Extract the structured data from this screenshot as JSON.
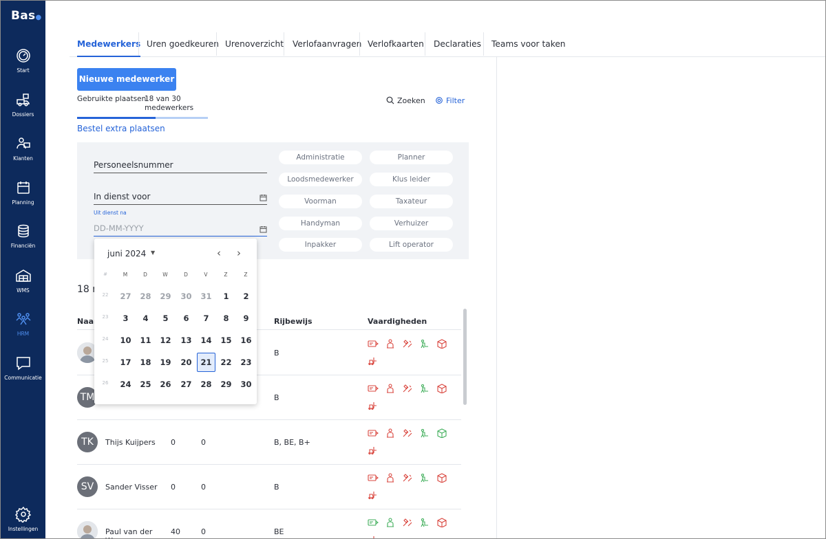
{
  "app": {
    "logo": "Bas"
  },
  "sidebar": {
    "items": [
      {
        "label": "Start",
        "icon": "gauge-icon"
      },
      {
        "label": "Dossiers",
        "icon": "truck-icon"
      },
      {
        "label": "Klanten",
        "icon": "customers-icon"
      },
      {
        "label": "Planning",
        "icon": "calendar-icon"
      },
      {
        "label": "Financiën",
        "icon": "coins-icon"
      },
      {
        "label": "WMS",
        "icon": "warehouse-icon"
      },
      {
        "label": "HRM",
        "icon": "people-icon",
        "active": true
      },
      {
        "label": "Communicatie",
        "icon": "chat-icon"
      },
      {
        "label": "Instellingen",
        "icon": "gear-icon"
      }
    ]
  },
  "tabs": [
    "Medewerkers",
    "Uren goedkeuren",
    "Urenoverzicht",
    "Verlofaanvragen",
    "Verlofkaarten",
    "Declaraties",
    "Teams voor taken"
  ],
  "toolbar": {
    "new_employee": "Nieuwe medewerker",
    "seats_label": "Gebruikte plaatsen",
    "seats_count": "18 van 30 medewerkers",
    "seats_used_fraction": 0.6,
    "order_link": "Bestel extra plaatsen",
    "search": "Zoeken",
    "filter": "Filter"
  },
  "filters": {
    "personnel_number": "Personeelsnummer",
    "in_service_before": "In dienst voor",
    "out_of_service_after_label": "Uit dienst na",
    "out_of_service_after_placeholder": "DD-MM-YYYY",
    "roles": [
      "Administratie",
      "Planner",
      "Loodsmedewerker",
      "Klus leider",
      "Voorman",
      "Taxateur",
      "Handyman",
      "Verhuizer",
      "Inpakker",
      "Lift operator"
    ]
  },
  "list": {
    "count_text": "18 r",
    "headers": {
      "name": "Naar",
      "license": "Rijbewijs",
      "skills": "Vaardigheden"
    },
    "rows": [
      {
        "initials": "",
        "photo": true,
        "name": "",
        "c1": "",
        "c2": "",
        "license": "B",
        "skills": [
          "red",
          "red",
          "red",
          "green",
          "red",
          "red"
        ]
      },
      {
        "initials": "TM",
        "photo": false,
        "name": "",
        "c1": "",
        "c2": "",
        "license": "B",
        "skills": [
          "red",
          "red",
          "red",
          "green",
          "red",
          "red"
        ]
      },
      {
        "initials": "TK",
        "photo": false,
        "name": "Thijs Kuijpers",
        "c1": "0",
        "c2": "0",
        "license": "B, BE, B+",
        "skills": [
          "red",
          "red",
          "red",
          "green",
          "green",
          "red"
        ]
      },
      {
        "initials": "SV",
        "photo": false,
        "name": "Sander Visser",
        "c1": "0",
        "c2": "0",
        "license": "B",
        "skills": [
          "red",
          "red",
          "red",
          "green",
          "red",
          "red"
        ]
      },
      {
        "initials": "",
        "photo": true,
        "name": "Paul van der Wees",
        "c1": "40",
        "c2": "0",
        "license": "BE",
        "skills": [
          "green",
          "green",
          "red",
          "green",
          "red",
          "red"
        ]
      }
    ]
  },
  "datepicker": {
    "month_label": "juni 2024",
    "week_header": "#",
    "weekdays": [
      "M",
      "D",
      "W",
      "D",
      "V",
      "Z",
      "Z"
    ],
    "weeks": [
      {
        "wk": "22",
        "days": [
          "27",
          "28",
          "29",
          "30",
          "31",
          "1",
          "2"
        ],
        "muted": [
          true,
          true,
          true,
          true,
          true,
          false,
          false
        ]
      },
      {
        "wk": "23",
        "days": [
          "3",
          "4",
          "5",
          "6",
          "7",
          "8",
          "9"
        ],
        "muted": [
          false,
          false,
          false,
          false,
          false,
          false,
          false
        ]
      },
      {
        "wk": "24",
        "days": [
          "10",
          "11",
          "12",
          "13",
          "14",
          "15",
          "16"
        ],
        "muted": [
          false,
          false,
          false,
          false,
          false,
          false,
          false
        ]
      },
      {
        "wk": "25",
        "days": [
          "17",
          "18",
          "19",
          "20",
          "21",
          "22",
          "23"
        ],
        "muted": [
          false,
          false,
          false,
          false,
          false,
          false,
          false
        ]
      },
      {
        "wk": "26",
        "days": [
          "24",
          "25",
          "26",
          "27",
          "28",
          "29",
          "30"
        ],
        "muted": [
          false,
          false,
          false,
          false,
          false,
          false,
          false
        ]
      }
    ],
    "selected_day": "21",
    "skill_colors": {
      "red": "#d9443c",
      "green": "#3fae5a"
    }
  }
}
